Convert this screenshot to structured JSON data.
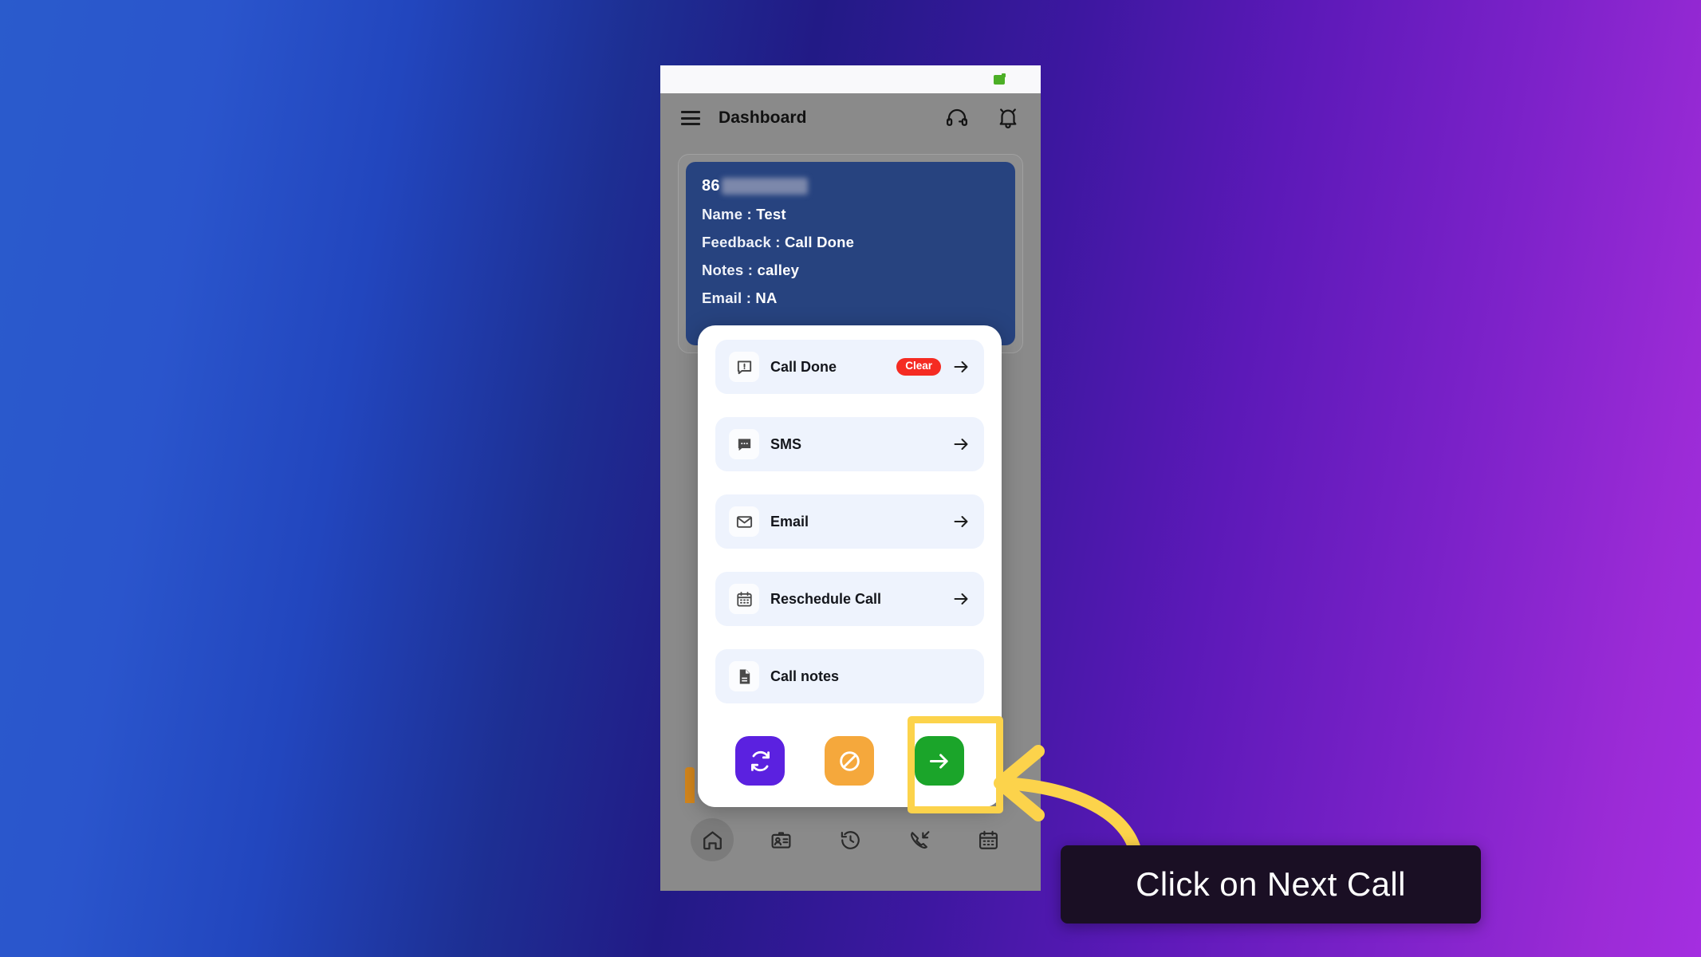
{
  "theme": {
    "bg_gradient_start": "#2a5bcc",
    "bg_gradient_end": "#a42ee0",
    "highlight_color": "#fcd34b",
    "badge_color": "#f52b22",
    "green_button": "#1ba52a",
    "purple_button": "#5b21e0",
    "orange_button": "#f5a83c",
    "card_color": "#27437f"
  },
  "status_bar": {
    "indicator": "wifi-signal-indicator"
  },
  "header": {
    "menu_icon": "hamburger-menu-icon",
    "title": "Dashboard",
    "support_icon": "headset-icon",
    "notification_icon": "bell-icon"
  },
  "contact_card": {
    "phone_prefix": "86",
    "phone_redacted": true,
    "lines": [
      {
        "label": "Name :",
        "value": "Test"
      },
      {
        "label": "Feedback :",
        "value": "Call Done"
      },
      {
        "label": "Notes :",
        "value": "calley"
      },
      {
        "label": "Email :",
        "value": "NA"
      }
    ]
  },
  "modal": {
    "actions": [
      {
        "icon": "feedback-chat-icon",
        "label": "Call Done",
        "badge": "Clear",
        "has_arrow": true
      },
      {
        "icon": "sms-chat-icon",
        "label": "SMS",
        "badge": null,
        "has_arrow": true
      },
      {
        "icon": "envelope-icon",
        "label": "Email",
        "badge": null,
        "has_arrow": true
      },
      {
        "icon": "calendar-icon",
        "label": "Reschedule Call",
        "badge": null,
        "has_arrow": true
      },
      {
        "icon": "document-icon",
        "label": "Call notes",
        "badge": null,
        "has_arrow": false
      }
    ],
    "footer_buttons": [
      {
        "name": "redial-button",
        "icon": "refresh-icon",
        "color": "#5b21e0"
      },
      {
        "name": "skip-button",
        "icon": "block-icon",
        "color": "#f5a83c"
      },
      {
        "name": "next-call-button",
        "icon": "arrow-right-icon",
        "color": "#1ba52a"
      }
    ]
  },
  "bottom_nav": [
    {
      "name": "home",
      "icon": "home-icon",
      "active": true
    },
    {
      "name": "contacts",
      "icon": "contact-card-icon",
      "active": false
    },
    {
      "name": "history",
      "icon": "clock-history-icon",
      "active": false
    },
    {
      "name": "calls",
      "icon": "incoming-call-icon",
      "active": false
    },
    {
      "name": "schedule",
      "icon": "calendar-icon",
      "active": false
    }
  ],
  "callout": {
    "tooltip_text": "Click on Next Call",
    "arrow": "curved-arrow-pointing-left"
  }
}
